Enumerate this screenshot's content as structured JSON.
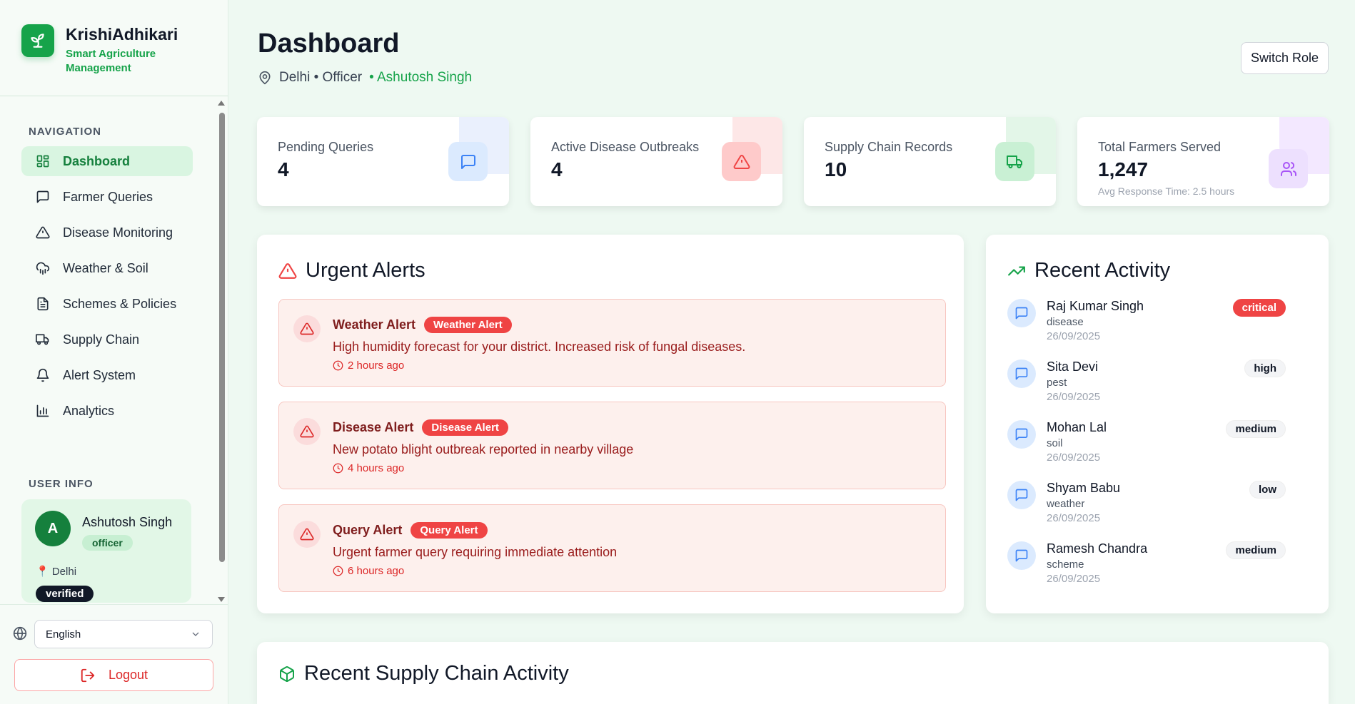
{
  "brand": {
    "title": "KrishiAdhikari",
    "subtitle": "Smart Agriculture Management"
  },
  "navigation": {
    "heading": "NAVIGATION",
    "items": [
      {
        "label": "Dashboard",
        "icon": "dashboard-icon",
        "active": true
      },
      {
        "label": "Farmer Queries",
        "icon": "message-icon"
      },
      {
        "label": "Disease Monitoring",
        "icon": "warning-icon"
      },
      {
        "label": "Weather & Soil",
        "icon": "cloud-rain-icon"
      },
      {
        "label": "Schemes & Policies",
        "icon": "document-icon"
      },
      {
        "label": "Supply Chain",
        "icon": "truck-icon"
      },
      {
        "label": "Alert System",
        "icon": "bell-icon"
      },
      {
        "label": "Analytics",
        "icon": "bar-chart-icon"
      }
    ]
  },
  "user_info": {
    "heading": "USER INFO",
    "initial": "A",
    "name": "Ashutosh Singh",
    "role": "officer",
    "location": "📍 Delhi",
    "status": "verified"
  },
  "footer": {
    "language": "English",
    "logout_label": "Logout"
  },
  "header": {
    "title": "Dashboard",
    "location": "Delhi • Officer",
    "user": "• Ashutosh Singh",
    "switch_role_label": "Switch Role"
  },
  "stats": [
    {
      "label": "Pending Queries",
      "value": "4",
      "icon": "message-icon",
      "color": "#3b82f6"
    },
    {
      "label": "Active Disease Outbreaks",
      "value": "4",
      "icon": "warning-icon",
      "color": "#ef4444"
    },
    {
      "label": "Supply Chain Records",
      "value": "10",
      "icon": "truck-icon",
      "color": "#16a34a"
    },
    {
      "label": "Total Farmers Served",
      "value": "1,247",
      "sub": "Avg Response Time: 2.5 hours",
      "icon": "users-icon",
      "color": "#a855f7"
    }
  ],
  "urgent_alerts": {
    "title": "Urgent Alerts",
    "items": [
      {
        "title": "Weather Alert",
        "badge": "Weather Alert",
        "text": "High humidity forecast for your district. Increased risk of fungal diseases.",
        "time": "2 hours ago"
      },
      {
        "title": "Disease Alert",
        "badge": "Disease Alert",
        "text": "New potato blight outbreak reported in nearby village",
        "time": "4 hours ago"
      },
      {
        "title": "Query Alert",
        "badge": "Query Alert",
        "text": "Urgent farmer query requiring immediate attention",
        "time": "6 hours ago"
      }
    ]
  },
  "recent_activity": {
    "title": "Recent Activity",
    "items": [
      {
        "name": "Raj Kumar Singh",
        "type": "disease",
        "date": "26/09/2025",
        "priority": "critical"
      },
      {
        "name": "Sita Devi",
        "type": "pest",
        "date": "26/09/2025",
        "priority": "high"
      },
      {
        "name": "Mohan Lal",
        "type": "soil",
        "date": "26/09/2025",
        "priority": "medium"
      },
      {
        "name": "Shyam Babu",
        "type": "weather",
        "date": "26/09/2025",
        "priority": "low"
      },
      {
        "name": "Ramesh Chandra",
        "type": "scheme",
        "date": "26/09/2025",
        "priority": "medium"
      }
    ]
  },
  "supply_chain": {
    "title": "Recent Supply Chain Activity"
  }
}
